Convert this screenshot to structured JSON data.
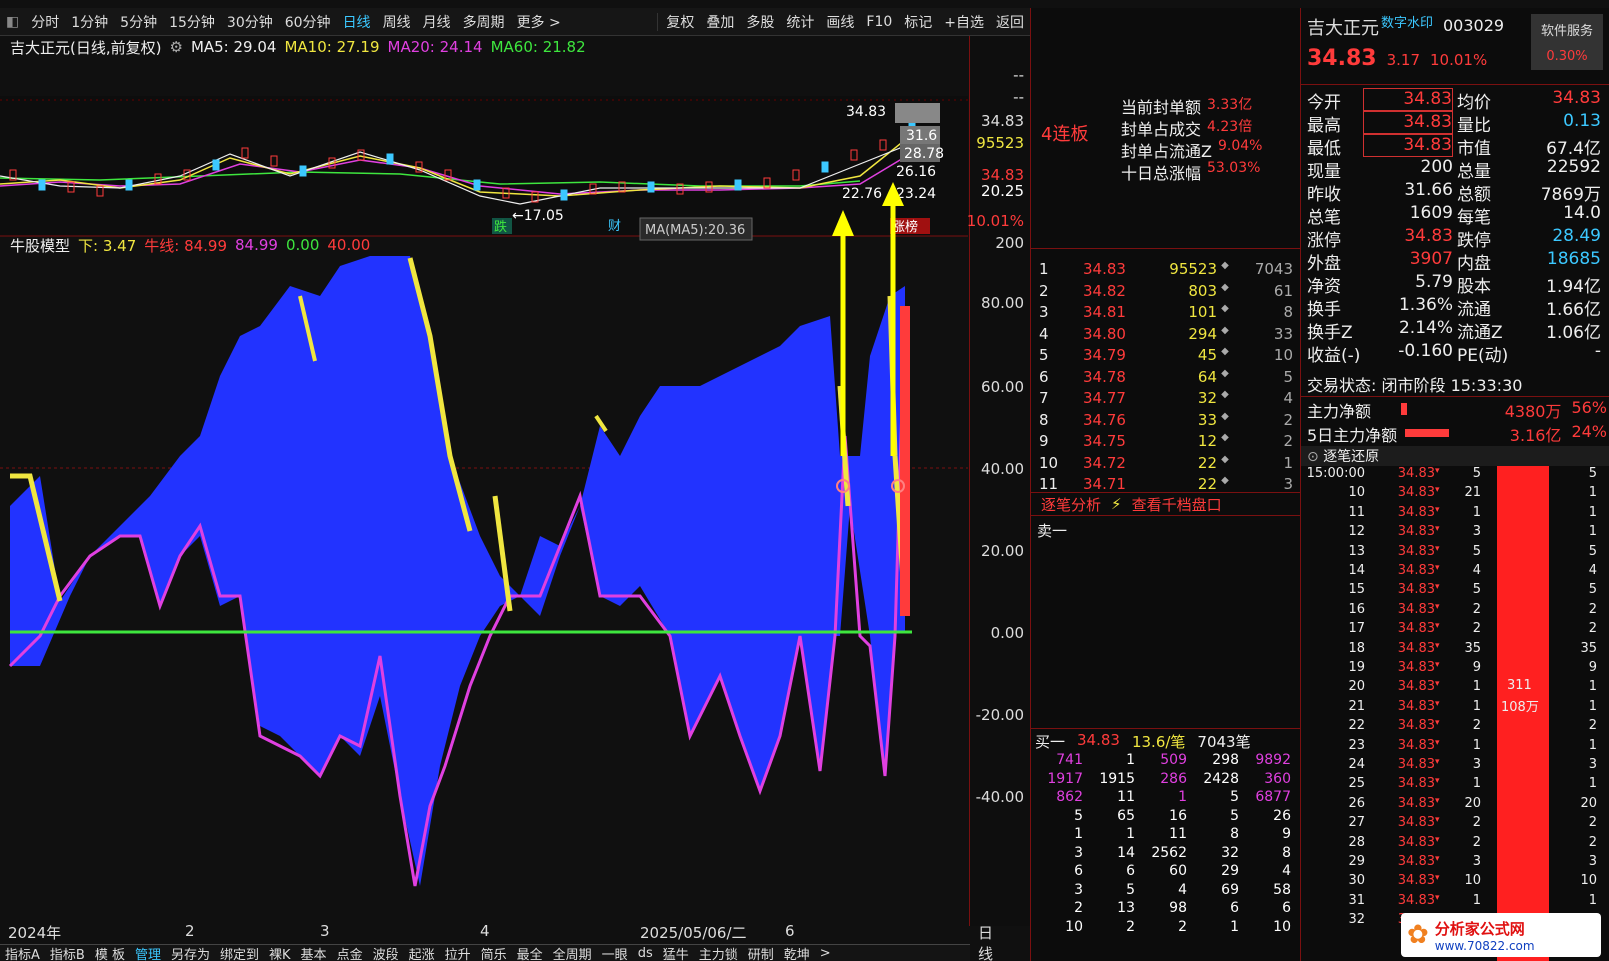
{
  "toolbar": {
    "periods": [
      "分时",
      "1分钟",
      "5分钟",
      "15分钟",
      "30分钟",
      "60分钟",
      "日线",
      "周线",
      "月线",
      "多周期",
      "更多 >"
    ],
    "actions": [
      "复权",
      "叠加",
      "多股",
      "统计",
      "画线",
      "F10",
      "标记",
      "+自选",
      "返回"
    ]
  },
  "main": {
    "title": "吉大正元(日线,前复权)",
    "ma5": "MA5: 29.04",
    "ma10": "MA10: 27.19",
    "ma20": "MA20: 24.14",
    "ma60": "MA60: 21.82",
    "price_high": "34.83",
    "price_low": "17.05",
    "price_tag1": "31.6",
    "price_tag2": "28.78",
    "price_tag3": "26.16",
    "price_tag4": "23.24",
    "price_tag5": "22.76",
    "ma_tooltip": "MA(MA5):20.36",
    "mark_die": "跌",
    "mark_cai": "财",
    "zhangbang": "涨榜",
    "arrow_low": "←17.05"
  },
  "axis": {
    "top": [
      "--",
      "--",
      "34.83",
      "95523",
      "34.83",
      "20.25",
      "10.01%"
    ],
    "indicator": [
      "200",
      "80.00",
      "60.00",
      "40.00",
      "20.00",
      "0.00",
      "-20.00",
      "-40.00"
    ]
  },
  "indicator": {
    "title": "牛股模型",
    "sub": "下: 3.47",
    "niu": "牛线: 84.99",
    "v1": "84.99",
    "v2": "0.00",
    "v3": "40.00"
  },
  "time": {
    "labels": [
      "2024年",
      "2",
      "3",
      "4",
      "2025/05/06/二",
      "6"
    ],
    "period": "日线"
  },
  "bottom_tabs": [
    "指标A",
    "指标B",
    "模 板",
    "管理",
    "另存为",
    "绑定到",
    "裸K",
    "基本",
    "点金",
    "波段",
    "起涨",
    "拉升",
    "简乐",
    "最全",
    "全周期",
    "一眼",
    "ds",
    "猛牛",
    "主力锁",
    "研制",
    "乾坤",
    ">"
  ],
  "mid": {
    "lianban": "4连板",
    "seal_rows": [
      {
        "k": "当前封单额",
        "v": "3.33亿"
      },
      {
        "k": "封单占成交",
        "v": "4.23倍"
      },
      {
        "k": "封单占流通Z",
        "v": "9.04%"
      },
      {
        "k": "十日总涨幅",
        "v": "53.03%"
      }
    ],
    "orders": [
      [
        "1",
        "34.83",
        "95523",
        "7043"
      ],
      [
        "2",
        "34.82",
        "803",
        "61"
      ],
      [
        "3",
        "34.81",
        "101",
        "8"
      ],
      [
        "4",
        "34.80",
        "294",
        "33"
      ],
      [
        "5",
        "34.79",
        "45",
        "10"
      ],
      [
        "6",
        "34.78",
        "64",
        "5"
      ],
      [
        "7",
        "34.77",
        "32",
        "4"
      ],
      [
        "8",
        "34.76",
        "33",
        "2"
      ],
      [
        "9",
        "34.75",
        "12",
        "2"
      ],
      [
        "10",
        "34.72",
        "22",
        "1"
      ],
      [
        "11",
        "34.71",
        "22",
        "3"
      ]
    ],
    "link1": "逐笔分析",
    "link2": "查看千档盘口",
    "sell1": "卖一",
    "buy1": "买一",
    "buy_price": "34.83",
    "buy_avg": "13.6/笔",
    "buy_count": "7043笔",
    "grid": [
      [
        "741",
        "1",
        "509",
        "298",
        "9892"
      ],
      [
        "1917",
        "1915",
        "286",
        "2428",
        "360"
      ],
      [
        "862",
        "11",
        "1",
        "5",
        "6877"
      ],
      [
        "5",
        "65",
        "16",
        "5",
        "26"
      ],
      [
        "1",
        "1",
        "11",
        "8",
        "9"
      ],
      [
        "3",
        "14",
        "2562",
        "32",
        "8"
      ],
      [
        "6",
        "6",
        "60",
        "29",
        "4"
      ],
      [
        "3",
        "5",
        "4",
        "69",
        "58"
      ],
      [
        "2",
        "13",
        "98",
        "6",
        "6"
      ],
      [
        "10",
        "2",
        "2",
        "1",
        "10"
      ]
    ]
  },
  "right": {
    "name": "吉大正元",
    "watermark": "数字水印",
    "code": "003029",
    "service": "软件服务",
    "price": "34.83",
    "change": "3.17",
    "pct": "10.01%",
    "svc_pct": "0.30%",
    "stats": [
      [
        "今开",
        "34.83",
        "均价",
        "34.83"
      ],
      [
        "最高",
        "34.83",
        "量比",
        "0.13"
      ],
      [
        "最低",
        "34.83",
        "市值",
        "67.4亿"
      ],
      [
        "现量",
        "200",
        "总量",
        "22592"
      ],
      [
        "昨收",
        "31.66",
        "总额",
        "7869万"
      ],
      [
        "总笔",
        "1609",
        "每笔",
        "14.0"
      ],
      [
        "涨停",
        "34.83",
        "跌停",
        "28.49"
      ],
      [
        "外盘",
        "3907",
        "内盘",
        "18685"
      ],
      [
        "净资",
        "5.79",
        "股本",
        "1.94亿"
      ],
      [
        "换手",
        "1.36%",
        "流通",
        "1.66亿"
      ],
      [
        "换手Z",
        "2.14%",
        "流通Z",
        "1.06亿"
      ],
      [
        "收益(-)",
        "-0.160",
        "PE(动)",
        "-"
      ]
    ],
    "trade_state": "交易状态: 闭市阶段 15:33:30",
    "zhuli": "主力净额",
    "zhuli_v": "4380万",
    "zhuli_p": "56%",
    "zhuli5": "5日主力净额",
    "zhuli5_v": "3.16亿",
    "zhuli5_p": "24%",
    "tick_title": "逐笔还原",
    "ticks": [
      [
        "15:00:00",
        "34.83",
        "5",
        "5"
      ],
      [
        "10",
        "34.83",
        "21",
        "1"
      ],
      [
        "11",
        "34.83",
        "1",
        "1"
      ],
      [
        "12",
        "34.83",
        "3",
        "1"
      ],
      [
        "13",
        "34.83",
        "5",
        "5"
      ],
      [
        "14",
        "34.83",
        "4",
        "4"
      ],
      [
        "15",
        "34.83",
        "5",
        "5"
      ],
      [
        "16",
        "34.83",
        "2",
        "2"
      ],
      [
        "17",
        "34.83",
        "2",
        "2"
      ],
      [
        "18",
        "34.83",
        "35",
        "35"
      ],
      [
        "19",
        "34.83",
        "9",
        "9"
      ],
      [
        "20",
        "34.83",
        "1",
        "1"
      ],
      [
        "21",
        "34.83",
        "1",
        "1"
      ],
      [
        "22",
        "34.83",
        "2",
        "2"
      ],
      [
        "23",
        "34.83",
        "1",
        "1"
      ],
      [
        "24",
        "34.83",
        "3",
        "3"
      ],
      [
        "25",
        "34.83",
        "1",
        "1"
      ],
      [
        "26",
        "34.83",
        "20",
        "20"
      ],
      [
        "27",
        "34.83",
        "2",
        "2"
      ],
      [
        "28",
        "34.83",
        "2",
        "2"
      ],
      [
        "29",
        "34.83",
        "3",
        "3"
      ],
      [
        "30",
        "34.83",
        "10",
        "10"
      ],
      [
        "31",
        "34.83",
        "1",
        "1"
      ],
      [
        "32",
        "34.83",
        "1",
        "1"
      ]
    ],
    "bar_label1": "311",
    "bar_label2": "108万",
    "site": "分析家公式网",
    "site_url": "www.70822.com"
  }
}
